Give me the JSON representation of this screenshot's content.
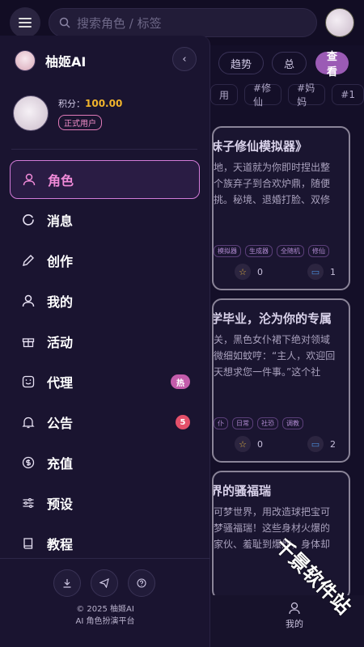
{
  "topbar": {
    "search_placeholder": "搜索角色 / 标签"
  },
  "filters": {
    "chips": [
      "趋势",
      "总"
    ],
    "view_button": "查看",
    "tags": [
      "用",
      "#修仙",
      "#妈妈",
      "#1"
    ]
  },
  "cards": [
    {
      "title": "妹子修仙模拟器》",
      "desc": "地，天道就为你即时捏出整个族弃子到合欢炉鼎，随便挑。秘境、退婚打脸、双修情劫…",
      "tags": [
        "模拟器",
        "生成器",
        "全随机",
        "修仙"
      ],
      "stars": "0",
      "comments": "1"
    },
    {
      "title": "学毕业，沦为你的专属",
      "desc": "关，黑色女仆裙下绝对领域微细如蚊哼：“主人，欢迎回天想求您一件事。”这个社恐…",
      "tags": [
        "仆",
        "日常",
        "社恐",
        "调教"
      ],
      "stars": "0",
      "comments": "2"
    },
    {
      "title": "界的骚福瑞",
      "desc": "可梦世界，用改造球把宝可梦骚福瑞！这些身材火爆的家伙、羞耻到爆炸，身体却湿热…",
      "tags": [],
      "stars": "",
      "comments": ""
    }
  ],
  "bottomnav": {
    "me_label": "我的"
  },
  "watermark": "千景软件站",
  "drawer": {
    "brand": "柚姬AI",
    "points_label": "积分：",
    "points_value": "100.00",
    "badge": "正式用户",
    "nav": [
      {
        "label": "角色",
        "icon": "user-icon",
        "active": true
      },
      {
        "label": "消息",
        "icon": "message-icon"
      },
      {
        "label": "创作",
        "icon": "pencil-icon"
      },
      {
        "label": "我的",
        "icon": "profile-icon"
      },
      {
        "label": "活动",
        "icon": "gift-icon"
      },
      {
        "label": "代理",
        "icon": "smile-icon",
        "badge": "热"
      },
      {
        "label": "公告",
        "icon": "bell-icon",
        "badge": "5"
      },
      {
        "label": "充值",
        "icon": "coin-icon"
      },
      {
        "label": "预设",
        "icon": "sliders-icon"
      },
      {
        "label": "教程",
        "icon": "book-icon"
      }
    ],
    "copyright": "© 2025 柚姬AI",
    "tagline": "AI 角色扮演平台"
  },
  "colors": {
    "accent": "#f08ad8",
    "points": "#f2b52c",
    "view_button": "#9b5bb5"
  }
}
